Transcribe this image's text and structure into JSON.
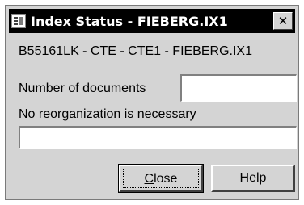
{
  "window": {
    "title": "Index Status - FIEBERG.IX1",
    "close_glyph": "✕",
    "accent_color": "#000000",
    "background_color": "#d4d4d4"
  },
  "content": {
    "index_path": "B55161LK - CTE - CTE1 - FIEBERG.IX1",
    "documents_label": "Number of documents",
    "documents_value": "",
    "reorg_message": "No reorganization is necessary",
    "reorg_value": ""
  },
  "buttons": {
    "close_label": "Close",
    "help_label": "Help"
  }
}
